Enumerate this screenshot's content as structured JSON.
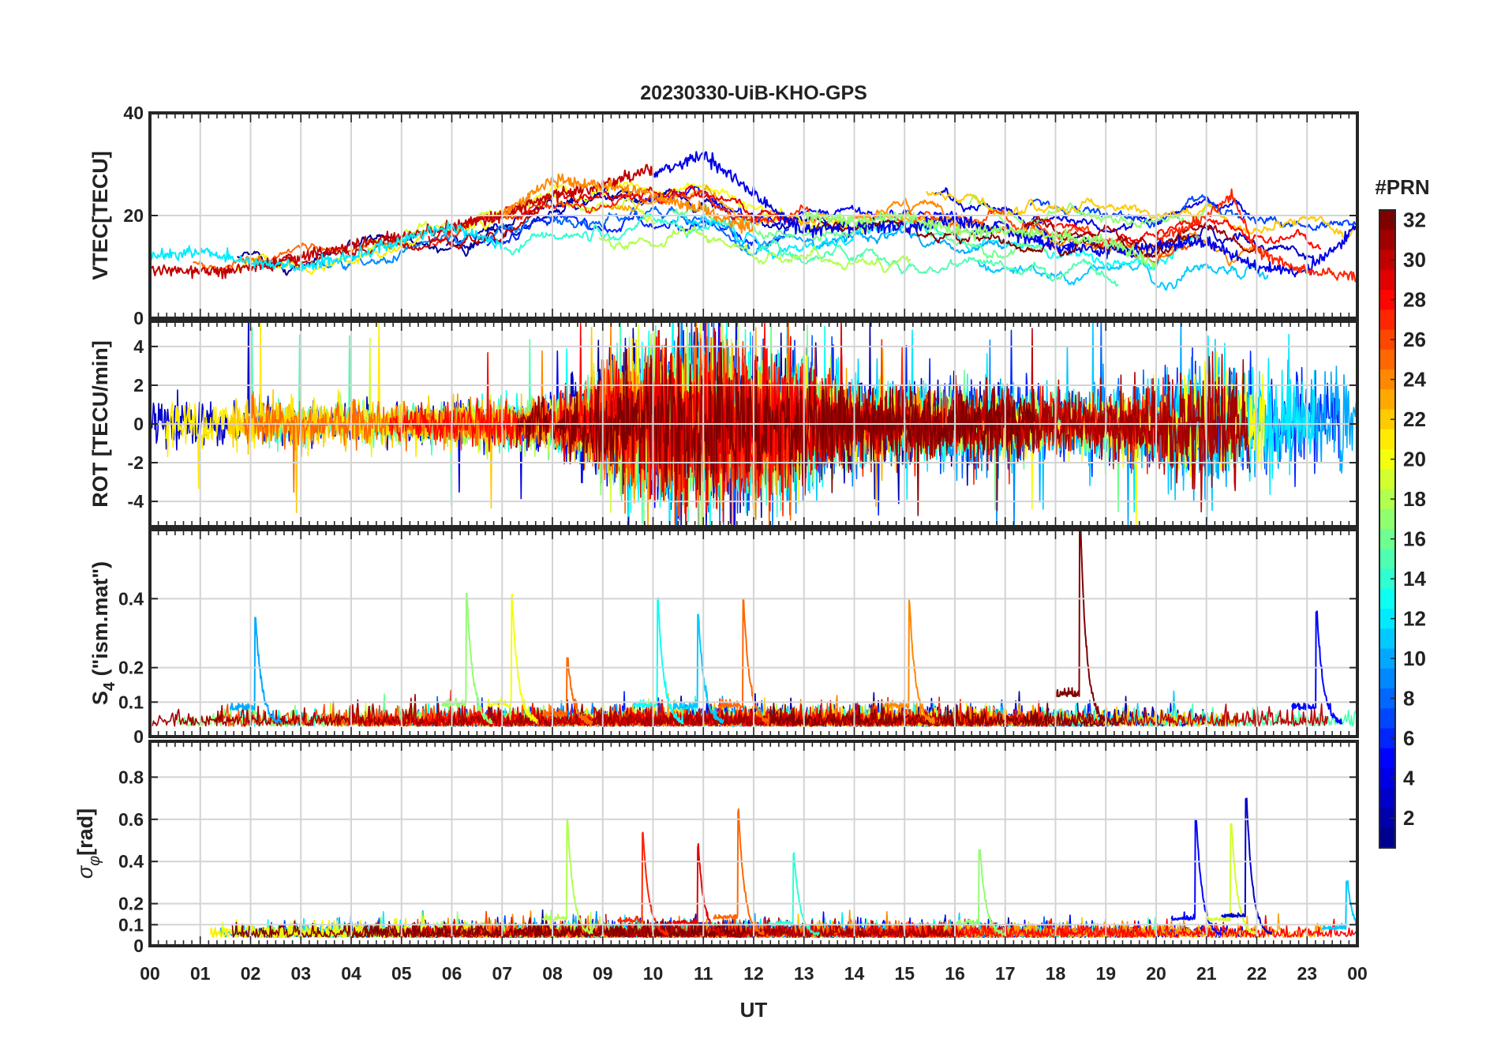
{
  "chart_data": {
    "type": "line",
    "title": "20230330-UiB-KHO-GPS",
    "xlabel": "UT",
    "x_tick_labels": [
      "00",
      "01",
      "02",
      "03",
      "04",
      "05",
      "06",
      "07",
      "08",
      "09",
      "10",
      "11",
      "12",
      "13",
      "14",
      "15",
      "16",
      "17",
      "18",
      "19",
      "20",
      "21",
      "22",
      "23",
      "00"
    ],
    "xlim": [
      0,
      24
    ],
    "grid": true,
    "colorbar": {
      "title": "#PRN",
      "range": [
        1,
        32
      ],
      "ticks": [
        2,
        4,
        6,
        8,
        10,
        12,
        14,
        16,
        18,
        20,
        22,
        24,
        26,
        28,
        30,
        32
      ],
      "colormap": "jet",
      "colors": [
        "#00008f",
        "#0000ff",
        "#0080ff",
        "#00ffff",
        "#80ff80",
        "#ffff00",
        "#ff8000",
        "#ff0000",
        "#800000"
      ]
    },
    "panels": [
      {
        "name": "vtec",
        "ylabel": "VTEC[TECU]",
        "ylim": [
          0,
          40
        ],
        "yticks": [
          0,
          20,
          40
        ],
        "ytick_labels": [
          "0",
          "20",
          "40"
        ],
        "typical_envelope": {
          "x": [
            0,
            1,
            2,
            3,
            4,
            5,
            6,
            7,
            8,
            9,
            10,
            11,
            12,
            13,
            14,
            15,
            16,
            17,
            18,
            19,
            20,
            21,
            22,
            23,
            24
          ],
          "y": [
            10,
            10,
            10,
            11,
            13,
            14,
            16,
            18,
            22,
            22,
            22,
            23,
            19,
            18,
            19,
            19,
            18,
            16,
            15,
            14,
            13,
            16,
            12,
            12,
            11
          ]
        },
        "series_samples": [
          {
            "prn": 30,
            "x": [
              0,
              1,
              2,
              3,
              4,
              5,
              6,
              7,
              8,
              9,
              10
            ],
            "y": [
              9.5,
              9,
              10,
              12,
              14,
              16,
              18,
              20,
              24,
              26,
              29
            ]
          },
          {
            "prn": 4,
            "x": [
              10,
              11,
              12,
              13,
              14,
              15,
              16,
              17,
              18,
              19,
              20,
              21,
              22,
              23,
              24
            ],
            "y": [
              28,
              32,
              24,
              17,
              18,
              18,
              19,
              17,
              14,
              13,
              14,
              15,
              10,
              9,
              18
            ]
          },
          {
            "prn": 12,
            "x": [
              0,
              1,
              2,
              3,
              4,
              5,
              6,
              7
            ],
            "y": [
              12,
              13,
              11,
              10,
              12,
              15,
              18,
              14
            ]
          },
          {
            "prn": 24,
            "x": [
              7,
              8,
              9,
              10,
              11,
              12
            ],
            "y": [
              20,
              27,
              26,
              24,
              21,
              17
            ]
          },
          {
            "prn": 17,
            "x": [
              13,
              14,
              15,
              16,
              17,
              18,
              19,
              20
            ],
            "y": [
              20,
              19,
              20,
              17,
              17,
              16,
              15,
              11
            ]
          },
          {
            "prn": 27,
            "x": [
              20,
              21,
              21.5,
              22,
              23,
              24
            ],
            "y": [
              15,
              20,
              24,
              13,
              9,
              8
            ]
          }
        ]
      },
      {
        "name": "rot",
        "ylabel": "ROT [TECU/min]",
        "ylim": [
          -5.3,
          5.3
        ],
        "yticks": [
          -4,
          -2,
          0,
          2,
          4
        ],
        "ytick_labels": [
          "-4",
          "-2",
          "0",
          "2",
          "4"
        ],
        "typical_amplitude": {
          "x": [
            0,
            2,
            4,
            6,
            8,
            9,
            10,
            11,
            12,
            13,
            14,
            15,
            16,
            17,
            18,
            19,
            20,
            21,
            22,
            23,
            24
          ],
          "y": [
            1.5,
            1.3,
            1.2,
            1.2,
            1.3,
            2.8,
            4.5,
            5,
            4,
            3.5,
            2.2,
            1.8,
            2,
            2,
            1.6,
            1.8,
            2.2,
            4,
            3,
            3,
            2.5
          ]
        }
      },
      {
        "name": "s4",
        "ylabel": "S4 (\"ism.mat\")",
        "ylabel_main": "S",
        "ylabel_subscript": "4",
        "ylabel_rest": " (\"ism.mat\")",
        "ylim": [
          0,
          0.6
        ],
        "yticks": [
          0,
          0.1,
          0.2,
          0.4
        ],
        "ytick_labels": [
          "0",
          "0.1",
          "0.2",
          "0.4"
        ],
        "baseline": 0.03,
        "peaks": [
          {
            "prn": 10,
            "x": 2.1,
            "y": 0.34
          },
          {
            "prn": 17,
            "x": 6.3,
            "y": 0.41
          },
          {
            "prn": 20,
            "x": 7.2,
            "y": 0.4
          },
          {
            "prn": 25,
            "x": 8.3,
            "y": 0.22
          },
          {
            "prn": 13,
            "x": 10.1,
            "y": 0.39
          },
          {
            "prn": 11,
            "x": 10.9,
            "y": 0.35
          },
          {
            "prn": 25,
            "x": 11.8,
            "y": 0.39
          },
          {
            "prn": 24,
            "x": 15.1,
            "y": 0.38
          },
          {
            "prn": 32,
            "x": 18.5,
            "y": 0.6
          },
          {
            "prn": 5,
            "x": 23.2,
            "y": 0.35
          }
        ]
      },
      {
        "name": "sigma_phi",
        "ylabel": "σφ[rad]",
        "ylabel_main": "σ",
        "ylabel_subscript": "φ",
        "ylabel_rest": "[rad]",
        "ylim": [
          0,
          0.97
        ],
        "yticks": [
          0,
          0.1,
          0.2,
          0.4,
          0.6,
          0.8
        ],
        "ytick_labels": [
          "0",
          "0.1",
          "0.2",
          "0.4",
          "0.6",
          "0.8"
        ],
        "baseline": 0.04,
        "peaks": [
          {
            "prn": 18,
            "x": 8.3,
            "y": 0.59
          },
          {
            "prn": 27,
            "x": 9.8,
            "y": 0.53
          },
          {
            "prn": 29,
            "x": 10.9,
            "y": 0.46
          },
          {
            "prn": 25,
            "x": 11.7,
            "y": 0.63
          },
          {
            "prn": 14,
            "x": 12.8,
            "y": 0.43
          },
          {
            "prn": 17,
            "x": 16.5,
            "y": 0.45
          },
          {
            "prn": 5,
            "x": 20.8,
            "y": 0.59
          },
          {
            "prn": 19,
            "x": 21.5,
            "y": 0.57
          },
          {
            "prn": 3,
            "x": 21.8,
            "y": 0.68
          },
          {
            "prn": 11,
            "x": 23.8,
            "y": 0.3
          }
        ]
      }
    ]
  }
}
